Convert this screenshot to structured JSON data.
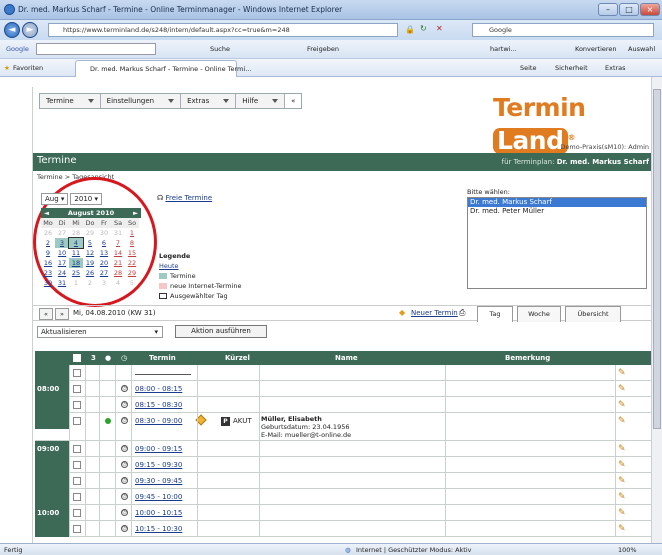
{
  "window": {
    "title": "Dr. med. Markus Scharf - Termine - Online Terminmanager - Windows Internet Explorer"
  },
  "addressbar": {
    "url": "https://www.terminland.de/s248/intern/default.aspx?cc=true&m=248",
    "search_engine": "Google"
  },
  "toolbar": {
    "google": "Google",
    "suche": "Suche",
    "freigeben": "Freigeben",
    "user": "hartwi...",
    "konvertieren": "Konvertieren",
    "auswahl": "Auswahl"
  },
  "favbar": {
    "favoriten": "Favoriten",
    "tab_title": "Dr. med. Markus Scharf - Termine - Online Termi...",
    "seite": "Seite",
    "sicherheit": "Sicherheit",
    "extras": "Extras"
  },
  "menu": [
    {
      "label": "Termine"
    },
    {
      "label": "Einstellungen"
    },
    {
      "label": "Extras"
    },
    {
      "label": "Hilfe"
    }
  ],
  "menu_collapse": "«",
  "logo": {
    "part1": "Termin",
    "part2": "Land",
    "reg": "®"
  },
  "user_line": "Demo-Praxis(sM10): Admin",
  "header": {
    "title": "Termine",
    "for_label": "für Terminplan:",
    "for_name": "Dr. med. Markus Scharf"
  },
  "breadcrumb": "Termine > Tagesansicht",
  "calendar": {
    "month_select": "Aug",
    "year_select": "2010",
    "header": "August 2010",
    "weekdays": [
      "Mo",
      "Di",
      "Mi",
      "Do",
      "Fr",
      "Sa",
      "So"
    ],
    "days": [
      {
        "d": "26",
        "c": "dim"
      },
      {
        "d": "27",
        "c": "dim"
      },
      {
        "d": "28",
        "c": "dim"
      },
      {
        "d": "29",
        "c": "dim"
      },
      {
        "d": "30",
        "c": "dim"
      },
      {
        "d": "31",
        "c": "dim"
      },
      {
        "d": "1",
        "c": "we"
      },
      {
        "d": "2",
        "c": ""
      },
      {
        "d": "3",
        "c": "term"
      },
      {
        "d": "4",
        "c": "sel4"
      },
      {
        "d": "5",
        "c": ""
      },
      {
        "d": "6",
        "c": ""
      },
      {
        "d": "7",
        "c": "we"
      },
      {
        "d": "8",
        "c": "we"
      },
      {
        "d": "9",
        "c": ""
      },
      {
        "d": "10",
        "c": ""
      },
      {
        "d": "11",
        "c": ""
      },
      {
        "d": "12",
        "c": ""
      },
      {
        "d": "13",
        "c": ""
      },
      {
        "d": "14",
        "c": "we"
      },
      {
        "d": "15",
        "c": "we"
      },
      {
        "d": "16",
        "c": ""
      },
      {
        "d": "17",
        "c": ""
      },
      {
        "d": "18",
        "c": "term"
      },
      {
        "d": "19",
        "c": ""
      },
      {
        "d": "20",
        "c": ""
      },
      {
        "d": "21",
        "c": "we"
      },
      {
        "d": "22",
        "c": "we"
      },
      {
        "d": "23",
        "c": ""
      },
      {
        "d": "24",
        "c": ""
      },
      {
        "d": "25",
        "c": ""
      },
      {
        "d": "26",
        "c": ""
      },
      {
        "d": "27",
        "c": ""
      },
      {
        "d": "28",
        "c": "we"
      },
      {
        "d": "29",
        "c": "we"
      },
      {
        "d": "30",
        "c": ""
      },
      {
        "d": "31",
        "c": ""
      },
      {
        "d": "1",
        "c": "dim"
      },
      {
        "d": "2",
        "c": "dim"
      },
      {
        "d": "3",
        "c": "dim"
      },
      {
        "d": "4",
        "c": "dim"
      },
      {
        "d": "5",
        "c": "dim"
      }
    ]
  },
  "freie_termine": "Freie Termine",
  "legend": {
    "title": "Legende",
    "heute": "Heute",
    "termine": "Termine",
    "neue": "neue Internet-Termine",
    "ausgewaehlt": "Ausgewählter Tag"
  },
  "picker": {
    "label": "Bitte wählen:",
    "options": [
      "Dr. med. Markus Scharf",
      "Dr. med. Peter Müller"
    ]
  },
  "nav": {
    "prev": "«",
    "next": "»",
    "date": "Mi, 04.08.2010 (KW 31)",
    "neuer_termin": "Neuer Termin",
    "tag": "Tag",
    "woche": "Woche",
    "uebersicht": "Übersicht"
  },
  "actions": {
    "select": "Aktualisieren",
    "button": "Aktion ausführen"
  },
  "table": {
    "headers": {
      "termin": "Termin",
      "kuerzel": "Kürzel",
      "name": "Name",
      "bemerkung": "Bemerkung",
      "col3": "3"
    },
    "rows": [
      {
        "hour": "",
        "time": ""
      },
      {
        "hour": "08:00",
        "time": "08:00 - 08:15"
      },
      {
        "hour": "",
        "time": "08:15 - 08:30"
      },
      {
        "hour": "",
        "time": "08:30 - 09:00",
        "appt": true,
        "kuerzel": "AKUT",
        "name": "Müller, Elisabeth",
        "geb": "Geburtsdatum: 23.04.1956",
        "mail": "E-Mail: mueller@t-online.de"
      },
      {
        "hour": "09:00",
        "time": "09:00 - 09:15"
      },
      {
        "hour": "",
        "time": "09:15 - 09:30"
      },
      {
        "hour": "",
        "time": "09:30 - 09:45"
      },
      {
        "hour": "",
        "time": "09:45 - 10:00"
      },
      {
        "hour": "10:00",
        "time": "10:00 - 10:15"
      },
      {
        "hour": "",
        "time": "10:15 - 10:30"
      }
    ]
  },
  "status": {
    "left": "Fertig",
    "zone": "Internet | Geschützter Modus: Aktiv",
    "zoom": "100%"
  }
}
